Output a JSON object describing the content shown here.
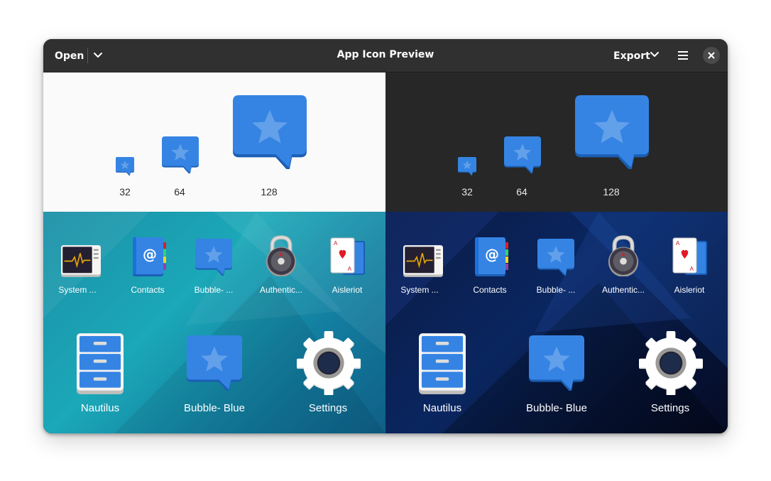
{
  "header": {
    "open_label": "Open",
    "open_menu_icon": "chevron-down-icon",
    "title": "App Icon Preview",
    "export_label": "Export",
    "export_menu_icon": "chevron-down-icon",
    "main_menu_icon": "hamburger-menu-icon",
    "close_icon": "close-icon"
  },
  "preview": {
    "light": {
      "sizes": [
        {
          "label": "32"
        },
        {
          "label": "64"
        },
        {
          "label": "128"
        }
      ]
    },
    "dark": {
      "sizes": [
        {
          "label": "32"
        },
        {
          "label": "64"
        },
        {
          "label": "128"
        }
      ]
    }
  },
  "grid": {
    "light": {
      "small_apps": [
        {
          "name": "System ...",
          "icon": "system-monitor-icon"
        },
        {
          "name": "Contacts",
          "icon": "contacts-icon"
        },
        {
          "name": "Bubble- ...",
          "icon": "bubble-star-icon"
        },
        {
          "name": "Authentic...",
          "icon": "padlock-icon"
        },
        {
          "name": "Aisleriot",
          "icon": "playing-cards-icon"
        }
      ],
      "large_apps": [
        {
          "name": "Nautilus",
          "icon": "file-cabinet-icon"
        },
        {
          "name": "Bubble- Blue",
          "icon": "bubble-star-icon"
        },
        {
          "name": "Settings",
          "icon": "gear-icon"
        }
      ]
    },
    "dark": {
      "small_apps": [
        {
          "name": "System ...",
          "icon": "system-monitor-icon"
        },
        {
          "name": "Contacts",
          "icon": "contacts-icon"
        },
        {
          "name": "Bubble- ...",
          "icon": "bubble-star-icon"
        },
        {
          "name": "Authentic...",
          "icon": "padlock-icon"
        },
        {
          "name": "Aisleriot",
          "icon": "playing-cards-icon"
        }
      ],
      "large_apps": [
        {
          "name": "Nautilus",
          "icon": "file-cabinet-icon"
        },
        {
          "name": "Bubble- Blue",
          "icon": "bubble-star-icon"
        },
        {
          "name": "Settings",
          "icon": "gear-icon"
        }
      ]
    }
  },
  "colors": {
    "accent_blue": "#3584e4",
    "headerbar": "#303030",
    "light_bg": "#fafafa",
    "dark_bg": "#272727"
  }
}
